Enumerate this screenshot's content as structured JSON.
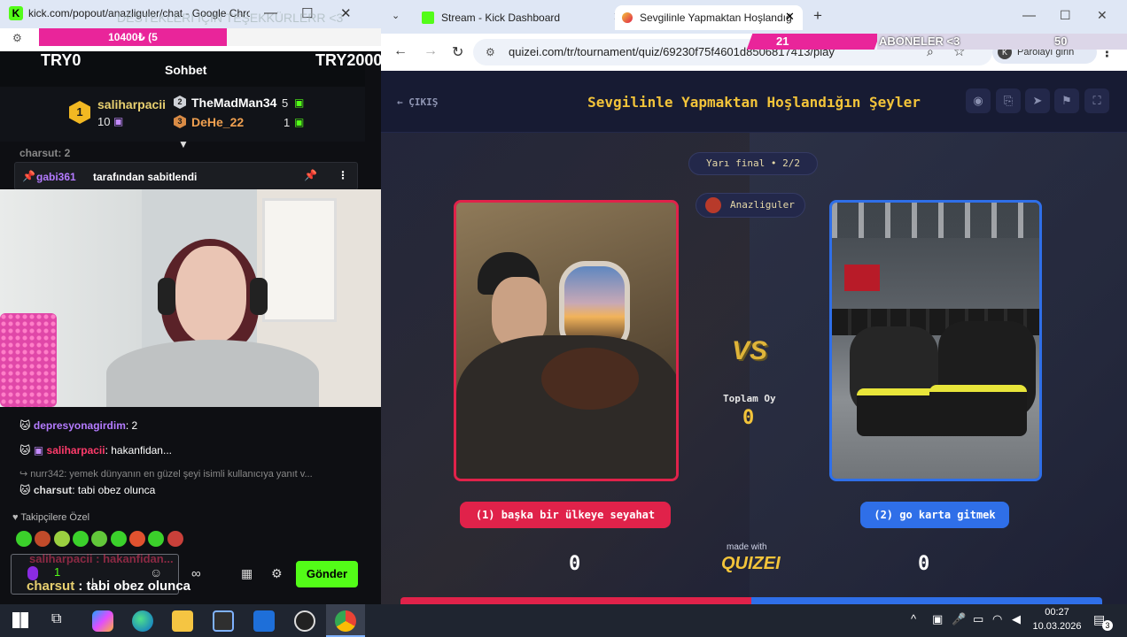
{
  "left_window": {
    "title": "kick.com/popout/anazliguler/chat - Google Chrome",
    "overlay_ticker": "DESTEKLERI IÇIN TEŞEKKÜRLERR <3",
    "overlay_progress": "10400₺ (5",
    "chat_header": {
      "left_value": "TRY0",
      "title": "Sohbet",
      "right_value": "TRY2000"
    },
    "leaderboard": [
      {
        "rank": "1",
        "name": "saliharpacii",
        "count": "10"
      },
      {
        "rank": "2",
        "name": "TheMadMan34",
        "count": "5"
      },
      {
        "rank": "3",
        "name": "DeHe_22",
        "count": "1"
      }
    ],
    "faded_top_msg": "charsut: 2",
    "pinned": {
      "user": "gabi361",
      "text": "tarafından sabitlendi"
    },
    "messages": [
      {
        "user": "depresyonagirdim",
        "text": ": 2"
      },
      {
        "user": "saliharpacii",
        "text": ": hakanfidan..."
      },
      {
        "reply": "nurr342: yemek dünyanın en güzel şeyi isimli kullanıcıya yanıt v..."
      },
      {
        "user": "charsut",
        "text": ": tabi obez olunca"
      }
    ],
    "followers_label": "Takipçilere Özel",
    "input_ghost": "saliharpacii : hakanfidan...",
    "input_overlay_user": "charsut",
    "input_overlay_text": " : tabi obez olunca",
    "input_count": "1",
    "send_label": "Gönder"
  },
  "right_window": {
    "tabs": [
      {
        "label": "Stream - Kick Dashboard"
      },
      {
        "label": "Sevgilinle Yapmaktan Hoşlandığ"
      }
    ],
    "url": "quizei.com/tr/tournament/quiz/69230f75f4601d8506817413/play",
    "subscribers_overlay": {
      "left": "21",
      "label": "ABONELER <3",
      "right": "50"
    },
    "profile_label": "Parolayı girin",
    "quiz": {
      "exit_label": "ÇIKIŞ",
      "title": "Sevgilinle Yapmaktan Hoşlandığın Şeyler",
      "round_label": "Yarı final • 2/2",
      "host": "Anazliguler",
      "vs_label": "VS",
      "total_votes_label": "Toplam Oy",
      "total_votes": "0",
      "choice_1": "(1) başka bir ülkeye seyahat",
      "choice_2": "(2) go karta gitmek",
      "score_1": "0",
      "score_2": "0",
      "made_with": "made with",
      "brand": "QUIZEI"
    }
  },
  "taskbar": {
    "time": "00:27",
    "date": "10.03.2026",
    "notif_count": "3"
  },
  "colors": {
    "kick_green": "#53fc18",
    "quiz_gold": "#f3c43a",
    "choice_red": "#e0224a",
    "choice_blue": "#2f6fe8"
  }
}
